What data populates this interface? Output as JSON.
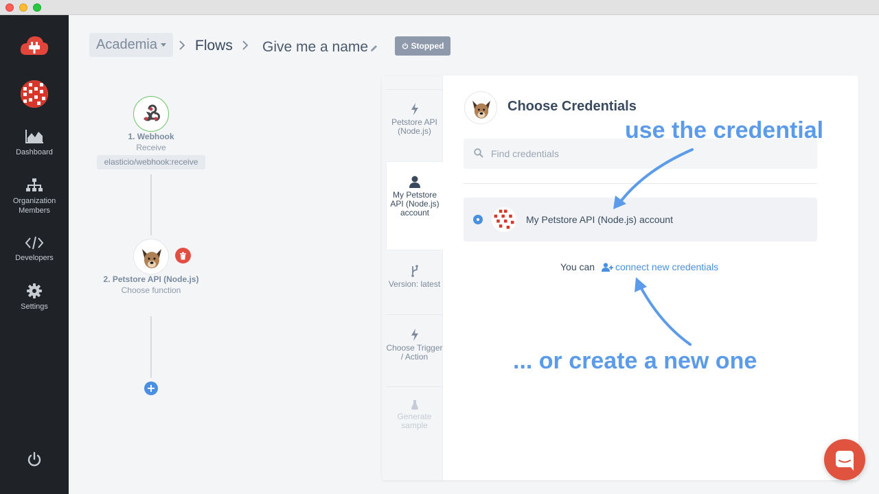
{
  "sidebar": {
    "items": [
      {
        "label": "Dashboard",
        "icon": "chart-icon"
      },
      {
        "label": "Organization Members",
        "icon": "org-icon"
      },
      {
        "label": "Developers",
        "icon": "code-icon"
      },
      {
        "label": "Settings",
        "icon": "gear-icon"
      }
    ]
  },
  "header": {
    "org": "Academia",
    "flows": "Flows",
    "flow_name": "Give me a name",
    "status": "Stopped"
  },
  "flow": {
    "steps": [
      {
        "title": "1. Webhook",
        "subtitle": "Receive",
        "tag": "elasticio/webhook:receive"
      },
      {
        "title": "2. Petstore API (Node.js)",
        "subtitle": "Choose function"
      }
    ]
  },
  "panel": {
    "rail": [
      {
        "label": "Petstore API (Node.js)",
        "icon": "bolt-icon"
      },
      {
        "label": "My Petstore API (Node.js) account",
        "icon": "user-icon"
      },
      {
        "label": "Version: latest",
        "icon": "branch-icon"
      },
      {
        "label": "Choose Trigger / Action",
        "icon": "bolt-icon"
      },
      {
        "label": "Generate sample",
        "icon": "flask-icon"
      }
    ],
    "title": "Choose Credentials",
    "search_placeholder": "Find credentials",
    "credential": "My Petstore API (Node.js) account",
    "connect_prefix": "You can",
    "connect_link": "connect new credentials"
  },
  "annotations": {
    "top": "use the credential",
    "bottom": "... or create a new one"
  },
  "colors": {
    "sidebar": "#1f2227",
    "accent": "#4a90e2",
    "annotation": "#5b9bea",
    "danger": "#e24e42",
    "chat": "#e0533f"
  }
}
